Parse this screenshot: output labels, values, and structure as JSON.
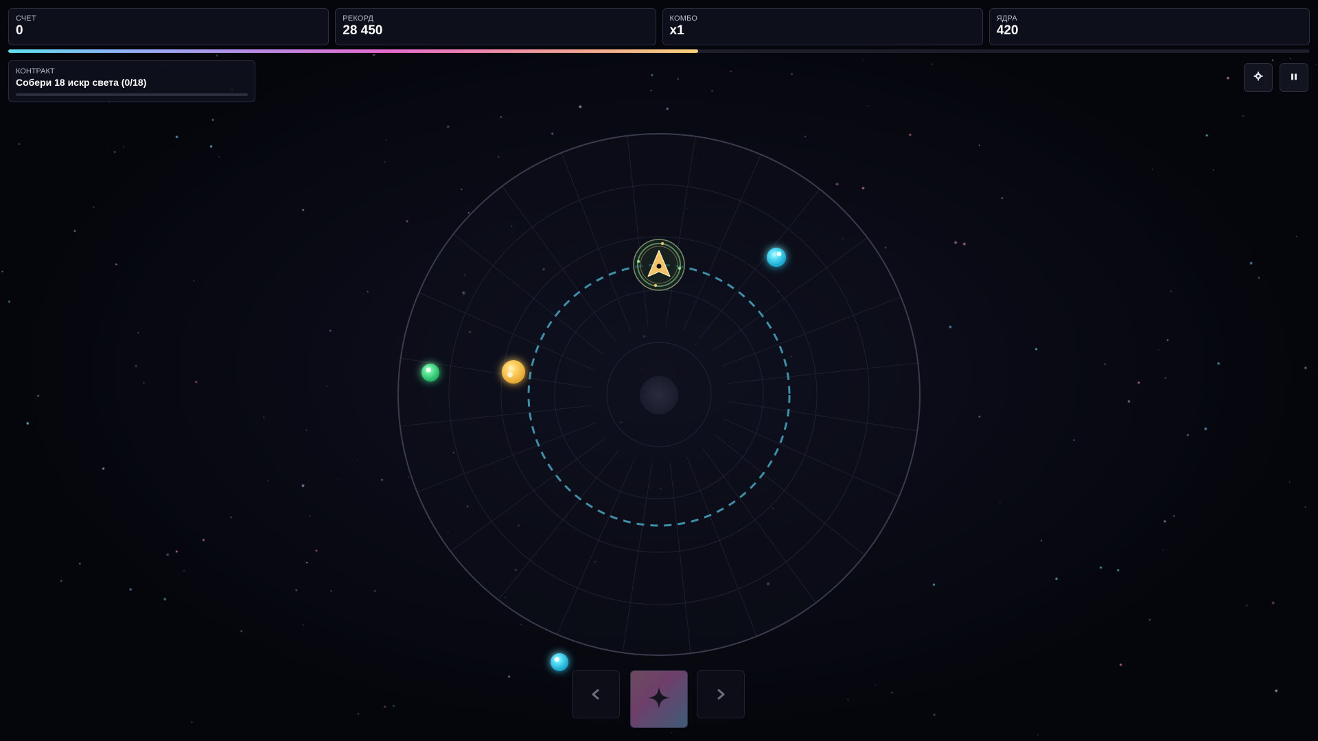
{
  "hud": {
    "score": {
      "label": "СЧЕТ",
      "value": "0"
    },
    "record": {
      "label": "РЕКОРД",
      "value": "28 450"
    },
    "combo": {
      "label": "КОМБО",
      "value": "x1"
    },
    "cores": {
      "label": "ЯДРА",
      "value": "420"
    }
  },
  "level_progress": 0.53,
  "contract": {
    "label": "КОНТРАКТ",
    "text": "Собери 18 искр света (0/18)",
    "progress": 0
  },
  "buttons": {
    "settings_icon": "gear-icon",
    "pause_icon": "pause-icon",
    "prev_icon": "chevron-left-icon",
    "ability_icon": "sparkle-icon",
    "next_icon": "chevron-right-icon"
  },
  "colors": {
    "orb_cyan": "#3fd6f2",
    "orb_green": "#4ee08c",
    "orb_yellow": "#ffd056",
    "orbit_dashed": "#3f8fa8",
    "ship": "#f2c46a"
  }
}
